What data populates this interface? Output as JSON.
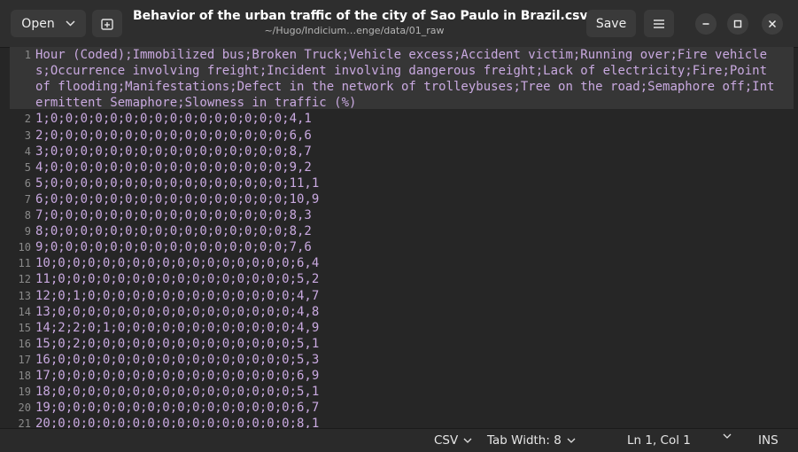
{
  "header": {
    "open_label": "Open",
    "save_label": "Save",
    "title": "Behavior of the urban traffic of the city of Sao Paulo in Brazil.csv",
    "subtitle": "~/Hugo/Indicium…enge/data/01_raw"
  },
  "editor": {
    "lines": [
      {
        "num": "1",
        "text": "Hour (Coded);Immobilized bus;Broken Truck;Vehicle excess;Accident victim;Running over;Fire vehicles;Occurrence involving freight;Incident involving dangerous freight;Lack of electricity;Fire;Point of flooding;Manifestations;Defect in the network of trolleybuses;Tree on the road;Semaphore off;Intermittent Semaphore;Slowness in traffic (%)"
      },
      {
        "num": "2",
        "text": "1;0;0;0;0;0;0;0;0;0;0;0;0;0;0;0;0;4,1"
      },
      {
        "num": "3",
        "text": "2;0;0;0;0;0;0;0;0;0;0;0;0;0;0;0;0;6,6"
      },
      {
        "num": "4",
        "text": "3;0;0;0;0;0;0;0;0;0;0;0;0;0;0;0;0;8,7"
      },
      {
        "num": "5",
        "text": "4;0;0;0;0;0;0;0;0;0;0;0;0;0;0;0;0;9,2"
      },
      {
        "num": "6",
        "text": "5;0;0;0;0;0;0;0;0;0;0;0;0;0;0;0;0;11,1"
      },
      {
        "num": "7",
        "text": "6;0;0;0;0;0;0;0;0;0;0;0;0;0;0;0;0;10,9"
      },
      {
        "num": "8",
        "text": "7;0;0;0;0;0;0;0;0;0;0;0;0;0;0;0;0;8,3"
      },
      {
        "num": "9",
        "text": "8;0;0;0;0;0;0;0;0;0;0;0;0;0;0;0;0;8,2"
      },
      {
        "num": "10",
        "text": "9;0;0;0;0;0;0;0;0;0;0;0;0;0;0;0;0;7,6"
      },
      {
        "num": "11",
        "text": "10;0;0;0;0;0;0;0;0;0;0;0;0;0;0;0;0;6,4"
      },
      {
        "num": "12",
        "text": "11;0;0;0;0;0;0;0;0;0;0;0;0;0;0;0;0;5,2"
      },
      {
        "num": "13",
        "text": "12;0;1;0;0;0;0;0;0;0;0;0;0;0;0;0;0;4,7"
      },
      {
        "num": "14",
        "text": "13;0;0;0;0;0;0;0;0;0;0;0;0;0;0;0;0;4,8"
      },
      {
        "num": "15",
        "text": "14;2;2;0;1;0;0;0;0;0;0;0;0;0;0;0;0;4,9"
      },
      {
        "num": "16",
        "text": "15;0;2;0;0;0;0;0;0;0;0;0;0;0;0;0;0;5,1"
      },
      {
        "num": "17",
        "text": "16;0;0;0;0;0;0;0;0;0;0;0;0;0;0;0;0;5,3"
      },
      {
        "num": "18",
        "text": "17;0;0;0;0;0;0;0;0;0;0;0;0;0;0;0;0;6,9"
      },
      {
        "num": "19",
        "text": "18;0;0;0;0;0;0;0;0;0;0;0;0;0;0;0;0;5,1"
      },
      {
        "num": "20",
        "text": "19;0;0;0;0;0;0;0;0;0;0;0;0;0;0;0;0;6,7"
      },
      {
        "num": "21",
        "text": "20;0;0;0;0;0;0;0;0;0;0;0;0;0;0;0;0;8,1"
      }
    ]
  },
  "statusbar": {
    "language": "CSV",
    "tab_width": "Tab Width: 8",
    "position": "Ln 1, Col 1",
    "mode": "INS"
  },
  "colors": {
    "text_color": "#c9a9e0",
    "line_number_color": "#8a8a8a"
  }
}
